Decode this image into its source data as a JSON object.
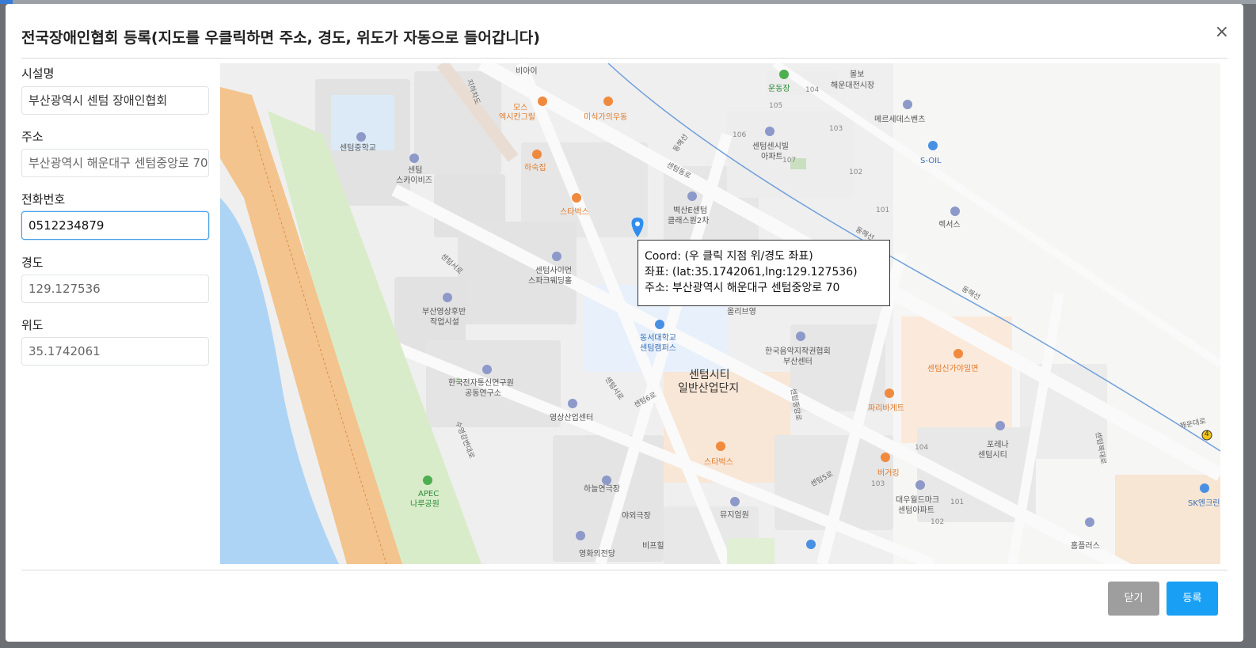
{
  "modal": {
    "title": "전국장애인협회 등록(지도를 우클릭하면 주소, 경도, 위도가 자동으로 들어갑니다)",
    "close_icon": "×"
  },
  "form": {
    "name_label": "시설명",
    "name_value": "부산광역시 센텀 장애인협회",
    "address_label": "주소",
    "address_value": "부산광역시 해운대구 센텀중앙로 70",
    "phone_label": "전화번호",
    "phone_value": "0512234879",
    "lng_label": "경도",
    "lng_value": "129.127536",
    "lat_label": "위도",
    "lat_value": "35.1742061"
  },
  "map": {
    "tooltip": {
      "line1": "Coord: (우 클릭 지점 위/경도 좌표)",
      "line2": "좌표: (lat:35.1742061,lng:129.127536)",
      "line3": "주소: 부산광역시 해운대구 센텀중앙로 70"
    },
    "labels": {
      "biai": "비아이",
      "mos": "모스",
      "mos2": "엑시칸그릴",
      "misik": "미식가의우동",
      "jihachado": "지하차도",
      "hasukjip": "하숙집",
      "centum_mid": "센텀중학교",
      "centum_sky": "센텀",
      "centum_sky2": "스카이비즈",
      "starbucks1": "스타벅스",
      "baeksan": "벽산E센텀",
      "baeksan2": "클래스원2차",
      "sion": "센텀사이언",
      "sion2": "스파크웨딩홀",
      "busan_film": "부산영상후반",
      "busan_film2": "작업시설",
      "dongseo": "동서대학교",
      "dongseo2": "센텀캠퍼스",
      "olive": "올리브영",
      "music": "한국음악지작권협회",
      "music2": "부산센터",
      "centum_city": "센텀시티",
      "centum_city2": "일반산업단지",
      "etri": "한국전자통신연구원",
      "etri2": "공동연구소",
      "film_ind": "영상산업센터",
      "paris": "파리바게트",
      "starbucks2": "스타벅스",
      "centum_shin": "센텀신가야밀면",
      "forena": "포레나",
      "forena2": "센텀시티",
      "burger": "버거킹",
      "daewoo": "대우월드마크",
      "daewoo2": "센텀아파트",
      "apec": "APEC",
      "apec2": "나루공원",
      "haneul": "하늘연극장",
      "outdoor": "야외극장",
      "museum": "뮤지엄원",
      "cinema": "영화의전당",
      "bif": "비프힐",
      "homeplus": "홈플러스",
      "sk": "SK엔크린",
      "lexus": "렉서스",
      "soil": "S-OIL",
      "mercedes": "메르세데스벤츠",
      "haeundae_market": "해운대전시장",
      "bolbo": "볼보",
      "undongjang": "운동장",
      "centum_apt": "센텀센시빌",
      "centum_apt2": "아파트",
      "centum_east": "센텀동로",
      "centum_west": "센텀서로",
      "centum_6": "센텀6로",
      "centum_5": "센텀5로",
      "centum_mid_rd": "센텀중앙로",
      "suyeong": "수영강변대로",
      "donghae": "동해선",
      "haeundae_rd": "해운대로",
      "centum_north": "센텀북대로",
      "n105": "105",
      "n104": "104",
      "n103": "103",
      "n106": "106",
      "n107": "107",
      "n102": "102",
      "n101": "101",
      "n104b": "104",
      "n103b": "103",
      "n101b": "101",
      "n102b": "102",
      "exit4": "4"
    }
  },
  "footer": {
    "close_label": "닫기",
    "submit_label": "등록"
  },
  "colors": {
    "primary": "#19a0f5",
    "secondary": "#9e9e9e",
    "river": "#aed4f5",
    "park": "#d9ecc9",
    "road_orange": "#f3c48d",
    "rail": "#6f9fdc"
  }
}
